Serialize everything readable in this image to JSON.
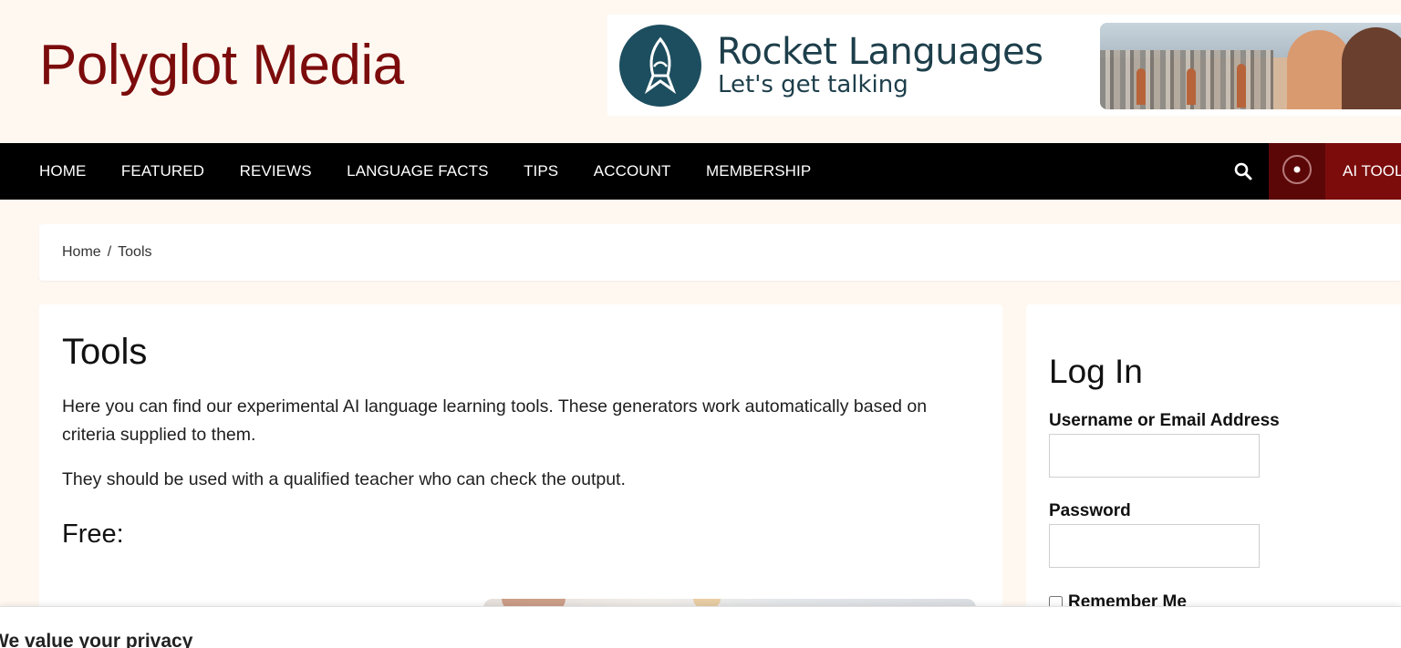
{
  "header": {
    "site_title": "Polyglot Media",
    "ad": {
      "brand": "Rocket Languages",
      "tagline": "Let's get talking",
      "accent_color": "#1d4e5f"
    },
    "brand_color": "#7c0c0c"
  },
  "nav": {
    "items": [
      {
        "label": "HOME"
      },
      {
        "label": "FEATURED"
      },
      {
        "label": "REVIEWS"
      },
      {
        "label": "LANGUAGE FACTS"
      },
      {
        "label": "TIPS"
      },
      {
        "label": "ACCOUNT"
      },
      {
        "label": "MEMBERSHIP"
      }
    ],
    "search_icon": "search-icon",
    "ai_icon": "target-circle-icon",
    "ai_tools_label": "AI TOOLS"
  },
  "breadcrumb": {
    "home": "Home",
    "separator": "/",
    "current": "Tools"
  },
  "main": {
    "title": "Tools",
    "paragraph1": "Here you can find our experimental AI language learning tools. These generators work automatically based on criteria supplied to them.",
    "paragraph2": "They should be used with a qualified teacher who can check the output.",
    "free_heading": "Free:"
  },
  "sidebar": {
    "login_title": "Log In",
    "username_label": "Username or Email Address",
    "username_value": "",
    "password_label": "Password",
    "password_value": "",
    "remember_label": "Remember Me"
  },
  "privacy": {
    "title": "We value your privacy"
  }
}
